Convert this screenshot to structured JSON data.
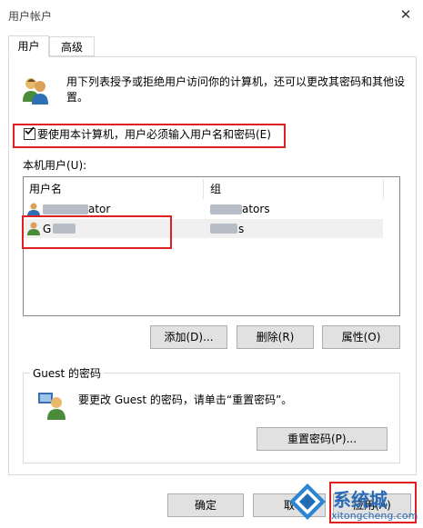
{
  "window": {
    "title": "用户帐户",
    "close_glyph": "✕"
  },
  "tabs": [
    {
      "label": "用户"
    },
    {
      "label": "高级"
    }
  ],
  "users_page": {
    "description": "用下列表授予或拒绝用户访问你的计算机，还可以更改其密码和其他设置。",
    "require_login": {
      "label": "要使用本计算机，用户必须输入用户名和密码(E)",
      "checked": true
    },
    "list_label": "本机用户(U):",
    "columns": [
      "用户名",
      "组"
    ],
    "rows": [
      {
        "username": "A···ator",
        "username_visible": "ator",
        "group_visible": "ators"
      },
      {
        "username_visible": "G",
        "group_visible": "s"
      }
    ],
    "buttons": {
      "add": "添加(D)...",
      "remove": "删除(R)",
      "properties": "属性(O)"
    }
  },
  "password_group": {
    "title": "Guest 的密码",
    "text": "要更改 Guest 的密码，请单击“重置密码”。",
    "reset_button": "重置密码(P)..."
  },
  "dialog_buttons": {
    "ok": "确定",
    "cancel": "取",
    "apply": "应用(A)"
  },
  "watermark": {
    "brand": "系统城",
    "url": "xitongcheng.com"
  },
  "highlight_color": "#e02020"
}
